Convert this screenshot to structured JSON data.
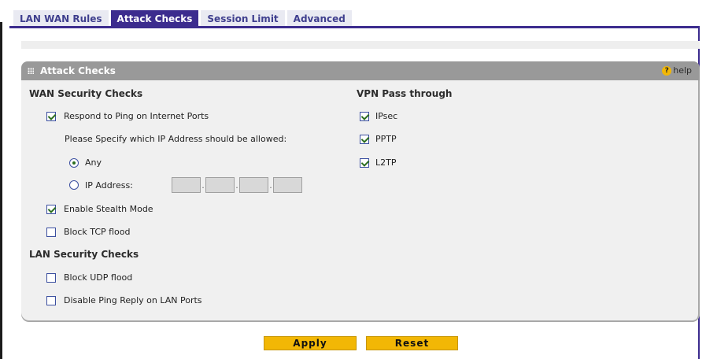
{
  "tabs": [
    {
      "label": "LAN WAN Rules"
    },
    {
      "label": "Attack Checks"
    },
    {
      "label": "Session Limit"
    },
    {
      "label": "Advanced"
    }
  ],
  "panel": {
    "title": "Attack Checks",
    "help_label": "help",
    "help_icon": "?"
  },
  "wan": {
    "heading": "WAN Security Checks",
    "respond_ping": {
      "label": "Respond to Ping on Internet Ports",
      "checked": true
    },
    "specify_text": "Please Specify which IP Address should be allowed:",
    "radio_any": {
      "label": "Any",
      "selected": true
    },
    "radio_ip": {
      "label": "IP Address:",
      "selected": false
    },
    "ip_octets": [
      "",
      "",
      "",
      ""
    ],
    "stealth": {
      "label": "Enable Stealth Mode",
      "checked": true
    },
    "tcp_flood": {
      "label": "Block TCP flood",
      "checked": false
    }
  },
  "lan": {
    "heading": "LAN Security Checks",
    "udp_flood": {
      "label": "Block UDP flood",
      "checked": false
    },
    "ping_reply": {
      "label": "Disable Ping Reply on LAN Ports",
      "checked": false
    }
  },
  "vpn": {
    "heading": "VPN Pass through",
    "ipsec": {
      "label": "IPsec",
      "checked": true
    },
    "pptp": {
      "label": "PPTP",
      "checked": true
    },
    "l2tp": {
      "label": "L2TP",
      "checked": true
    }
  },
  "buttons": {
    "apply": "Apply",
    "reset": "Reset"
  },
  "colors": {
    "accent": "#3c2c8e",
    "header": "#999999",
    "button": "#f2b705"
  }
}
